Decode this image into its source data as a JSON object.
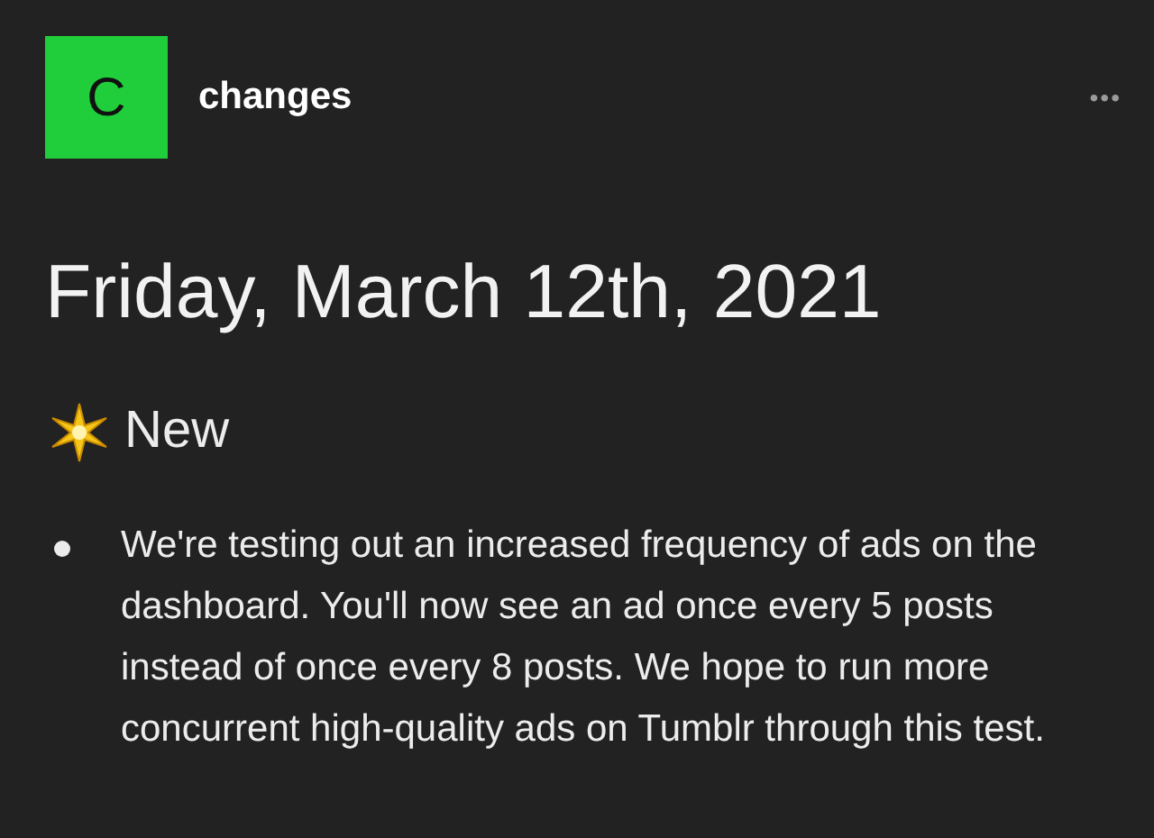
{
  "blog": {
    "avatar_letter": "C",
    "name": "changes"
  },
  "menu": {
    "label": "•••"
  },
  "post": {
    "date": "Friday, March 12th, 2021",
    "section": "New",
    "bullets": [
      "We're testing out an increased frequency of ads on the dashboard. You'll now see an ad once every 5 posts instead of once every 8 posts. We hope to run more concurrent high-quality ads on Tumblr through this test."
    ]
  }
}
